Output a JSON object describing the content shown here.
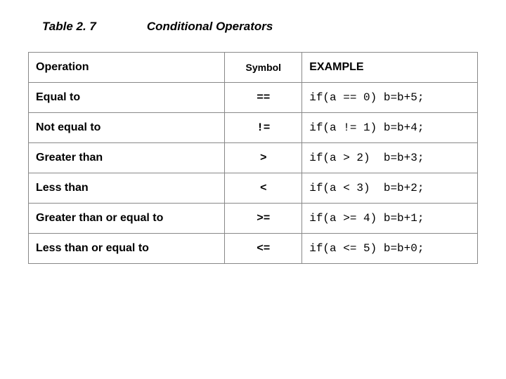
{
  "title": {
    "label": "Table 2. 7",
    "caption": "Conditional Operators"
  },
  "headers": {
    "operation": "Operation",
    "symbol": "Symbol",
    "example": "EXAMPLE"
  },
  "rows": [
    {
      "operation": "Equal to",
      "symbol": "==",
      "example": "if(a == 0) b=b+5;"
    },
    {
      "operation": "Not equal to",
      "symbol": "!=",
      "example": "if(a != 1) b=b+4;"
    },
    {
      "operation": "Greater than",
      "symbol": ">",
      "example": "if(a > 2)  b=b+3;"
    },
    {
      "operation": "Less than",
      "symbol": "<",
      "example": "if(a < 3)  b=b+2;"
    },
    {
      "operation": "Greater than or equal to",
      "symbol": ">=",
      "example": "if(a >= 4) b=b+1;"
    },
    {
      "operation": "Less than or equal to",
      "symbol": "<=",
      "example": "if(a <= 5) b=b+0;"
    }
  ],
  "chart_data": {
    "type": "table",
    "title": "Table 2.7 Conditional Operators",
    "columns": [
      "Operation",
      "Symbol",
      "EXAMPLE"
    ],
    "rows": [
      [
        "Equal to",
        "==",
        "if(a == 0) b=b+5;"
      ],
      [
        "Not equal to",
        "!=",
        "if(a != 1) b=b+4;"
      ],
      [
        "Greater than",
        ">",
        "if(a > 2)  b=b+3;"
      ],
      [
        "Less than",
        "<",
        "if(a < 3)  b=b+2;"
      ],
      [
        "Greater than or equal to",
        ">=",
        "if(a >= 4) b=b+1;"
      ],
      [
        "Less than or equal to",
        "<=",
        "if(a <= 5) b=b+0;"
      ]
    ]
  }
}
